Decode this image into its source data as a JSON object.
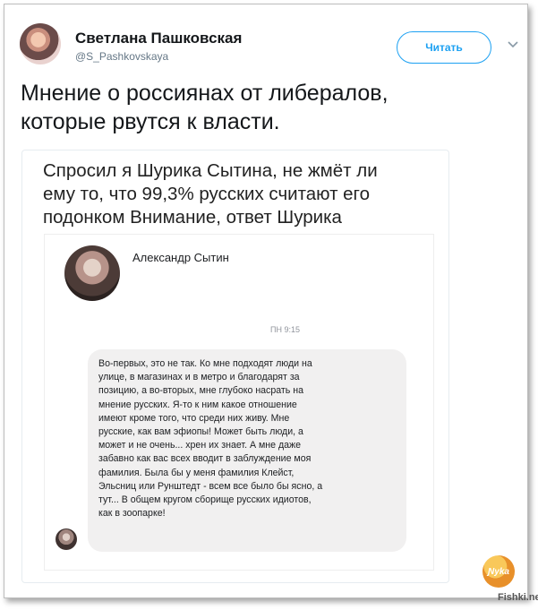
{
  "tweet": {
    "author_name": "Светлана Пашковская",
    "author_handle": "@S_Pashkovskaya",
    "read_button": "Читать",
    "text_line1": "Мнение о россиянах от либералов,",
    "text_line2": "которые рвутся к власти."
  },
  "card": {
    "caption_line1": "Спросил я Шурика Сытина, не жмёт ли",
    "caption_line2": "ему то, что 99,3% русских считают его",
    "caption_line3": "подонком Внимание, ответ Шурика"
  },
  "message": {
    "sender_name": "Александр Сытин",
    "timestamp": "ПН 9:15",
    "lines": [
      "Во-первых, это не так. Ко мне подходят люди на",
      "улице, в магазинах и в метро и благодарят за",
      "позицию, а во-вторых, мне глубоко насрать на",
      "мнение русских. Я-то к ним какое отношение",
      "имеют кроме того, что среди них живу. Мне",
      "русские, как вам эфиопы! Может быть люди, а",
      "может и не очень... хрен их знает. А мне даже",
      "забавно как вас всех вводит в заблуждение моя",
      "фамилия. Была бы у меня фамилия Клейст,",
      "Эльсниц или Рунштедт - всем все было бы ясно, а",
      "тут... В общем кругом сборище русских идиотов,",
      "как в зоопарке!"
    ]
  },
  "branding": {
    "logo_text": "Ɲyka",
    "watermark": "Fishki.net"
  },
  "colors": {
    "accent": "#1da1f2",
    "bubble": "#f1f0f0"
  },
  "icons": {
    "chevron": "chevron-down-icon"
  }
}
